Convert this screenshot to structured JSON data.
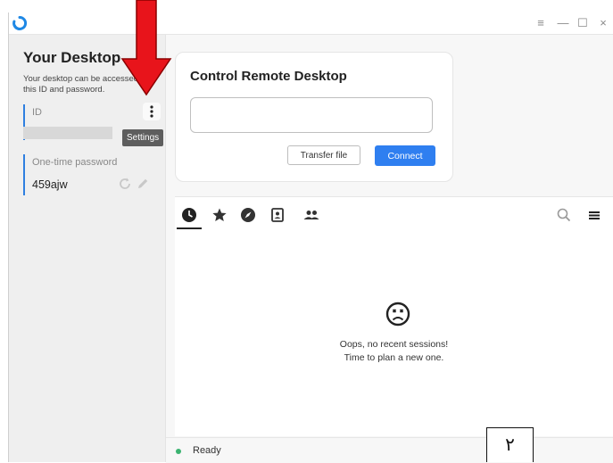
{
  "window": {
    "controls": {
      "menu": "≡",
      "minimize": "—",
      "maximize": "☐",
      "close": "×"
    }
  },
  "sidebar": {
    "title": "Your Desktop",
    "description": "Your desktop can be accessed with this ID and password.",
    "id_label": "ID",
    "password_label": "One-time password",
    "password_value": "459ajw",
    "settings_tooltip": "Settings"
  },
  "control": {
    "title": "Control Remote Desktop",
    "remote_id_value": "",
    "transfer_label": "Transfer file",
    "connect_label": "Connect"
  },
  "sessions": {
    "tabs": [
      {
        "name": "recent",
        "icon": "clock-icon",
        "active": true
      },
      {
        "name": "favorites",
        "icon": "star-icon"
      },
      {
        "name": "discovered",
        "icon": "compass-icon"
      },
      {
        "name": "address-book",
        "icon": "address-book-icon"
      },
      {
        "name": "group",
        "icon": "group-icon"
      }
    ],
    "empty_line1": "Oops, no recent sessions!",
    "empty_line2": "Time to plan a new one."
  },
  "status": {
    "text": "Ready"
  },
  "annotation": {
    "label": "٢"
  },
  "colors": {
    "accent": "#2f7ff0",
    "annotation_arrow": "#e8141b",
    "status_ok": "#3cb371"
  }
}
